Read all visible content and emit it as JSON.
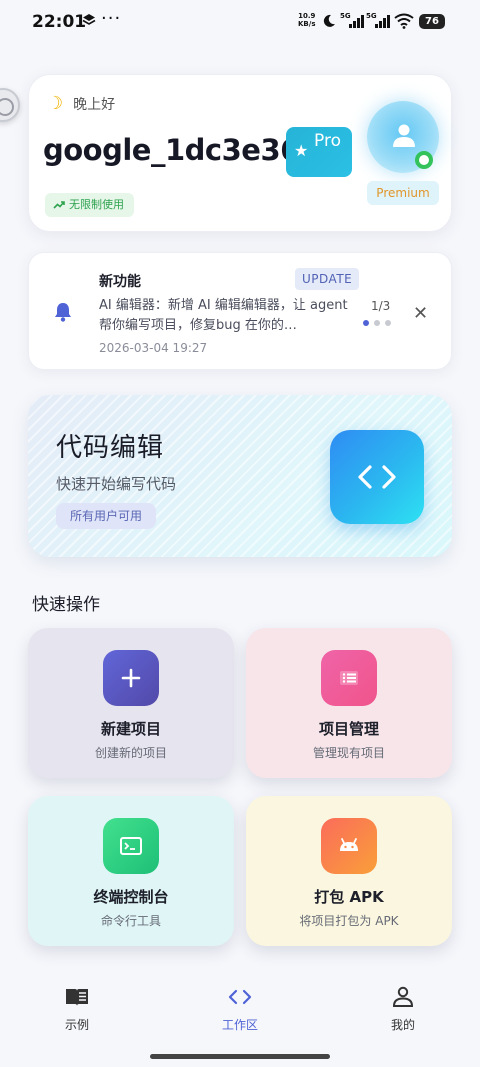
{
  "status_bar": {
    "time": "22:01",
    "dots": "···",
    "net_speed_value": "10.9",
    "net_speed_unit": "KB/s",
    "sim1": "5G",
    "sim2": "5G",
    "battery": "76"
  },
  "profile": {
    "greeting": "晚上好",
    "greeting_icon": "moon-icon",
    "username": "google_1dc3e369",
    "pro_label": "Pro",
    "premium_label": "Premium",
    "unlimited_label": "无限制使用"
  },
  "notice": {
    "title": "新功能",
    "badge": "UPDATE",
    "body": "AI 编辑器：新增 AI 编辑编辑器，让 agent 帮你编写项目，修复bug 在你的…",
    "date": "2026-03-04 19:27",
    "page_indicator": "1/3",
    "pages_total": 3,
    "page_current": 1
  },
  "code_editor": {
    "title": "代码编辑",
    "subtitle": "快速开始编写代码",
    "chip": "所有用户可用"
  },
  "quick_actions": {
    "section_title": "快速操作",
    "items": [
      {
        "label": "新建项目",
        "sub": "创建新的项目",
        "icon": "plus-icon"
      },
      {
        "label": "项目管理",
        "sub": "管理现有项目",
        "icon": "list-icon"
      },
      {
        "label": "终端控制台",
        "sub": "命令行工具",
        "icon": "terminal-icon"
      },
      {
        "label": "打包 APK",
        "sub": "将项目打包为 APK",
        "icon": "android-icon"
      }
    ]
  },
  "bottom_nav": {
    "items": [
      {
        "label": "示例",
        "icon": "book-icon"
      },
      {
        "label": "工作区",
        "icon": "code-icon"
      },
      {
        "label": "我的",
        "icon": "person-icon"
      }
    ],
    "active": "工作区"
  },
  "colors": {
    "accent": "#4f63d6",
    "pro_badge": "#26b4d8",
    "online": "#34c25b",
    "premium_text": "#e0962a"
  }
}
